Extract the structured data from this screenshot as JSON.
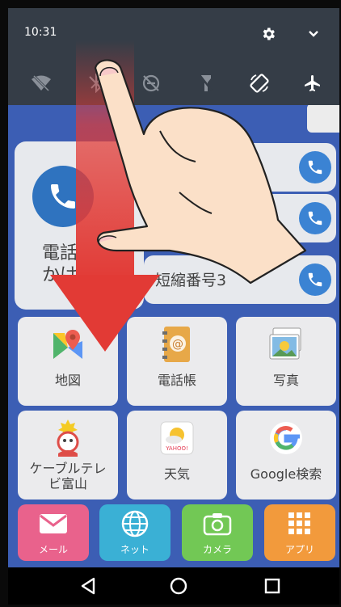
{
  "status_bar": {
    "time": "10:31",
    "icons": [
      "gear-icon",
      "chevron-down-icon"
    ]
  },
  "quick_settings": [
    {
      "icon": "wifi-off-icon",
      "state": "off"
    },
    {
      "icon": "bluetooth-off-icon",
      "state": "off"
    },
    {
      "icon": "do-not-disturb-off-icon",
      "state": "off"
    },
    {
      "icon": "flashlight-off-icon",
      "state": "off"
    },
    {
      "icon": "auto-rotate-icon",
      "state": "on"
    },
    {
      "icon": "airplane-mode-icon",
      "state": "on"
    }
  ],
  "phone": {
    "big_label_line1": "電話",
    "big_label_line2": "かけ",
    "speed_dials": [
      {
        "label": ""
      },
      {
        "label": "短"
      },
      {
        "label": "短縮番号3"
      }
    ]
  },
  "apps": [
    {
      "label": "地図",
      "icon": "maps-icon"
    },
    {
      "label": "電話帳",
      "icon": "address-book-icon"
    },
    {
      "label": "写真",
      "icon": "photos-icon"
    },
    {
      "label": "ケーブルテレ\nビ富山",
      "icon": "cable-tv-toyama-icon"
    },
    {
      "label": "天気",
      "icon": "weather-icon"
    },
    {
      "label": "Google検索",
      "icon": "google-search-icon"
    }
  ],
  "dock": [
    {
      "label": "メール",
      "icon": "mail-icon",
      "color": "#e6497a"
    },
    {
      "label": "ネット",
      "icon": "globe-icon",
      "color": "#1aa3cf"
    },
    {
      "label": "カメラ",
      "icon": "camera-icon",
      "color": "#5bbf3a"
    },
    {
      "label": "アプリ",
      "icon": "apps-grid-icon",
      "color": "#f08a1c"
    }
  ],
  "nav": [
    "back-icon",
    "home-icon",
    "recents-icon"
  ],
  "gesture": {
    "hint": "swipe-down",
    "arrow_color": "#d9302b"
  },
  "colors": {
    "shade": "#353d47",
    "home_bg": "#1c44a8",
    "navbar": "#000000"
  }
}
